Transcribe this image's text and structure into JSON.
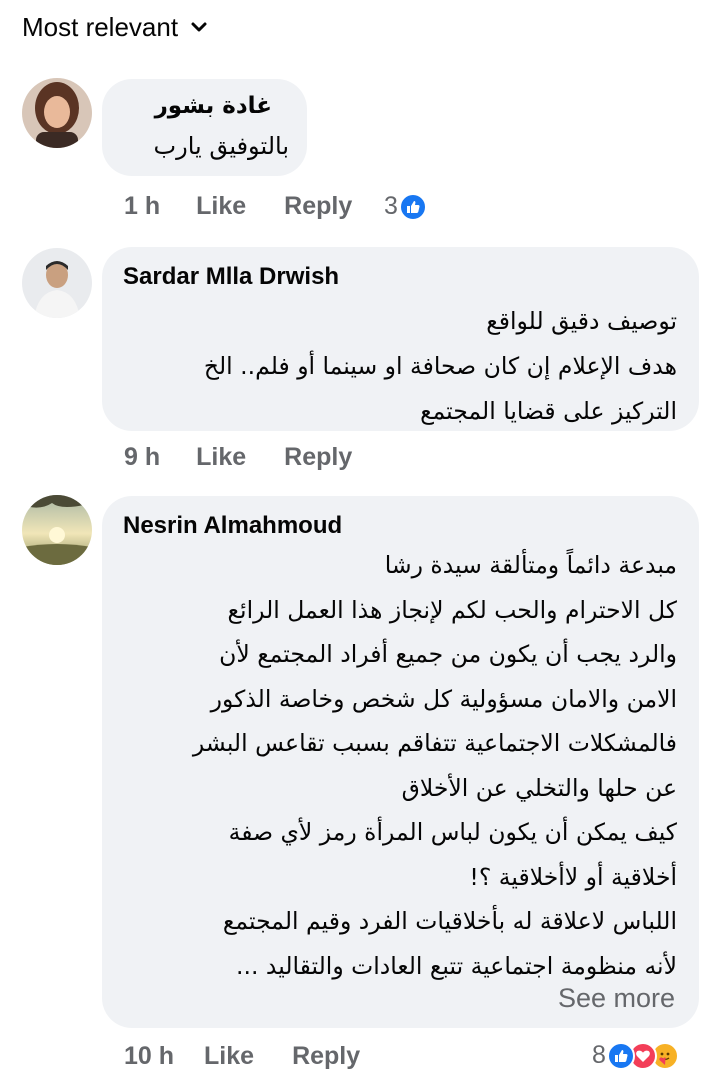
{
  "sort": {
    "label": "Most relevant"
  },
  "comments": [
    {
      "author": "غادة بشور",
      "lines": [
        "بالتوفيق يارب"
      ],
      "time": "1 h",
      "like": "Like",
      "reply": "Reply",
      "reaction_count": "3",
      "reactions": [
        "like-icon"
      ]
    },
    {
      "author": "Sardar Mlla Drwish",
      "lines": [
        "توصيف دقيق للواقع",
        "هدف الإعلام إن كان صحافة او سينما أو فلم.. الخ",
        "التركيز على قضايا المجتمع"
      ],
      "time": "9 h",
      "like": "Like",
      "reply": "Reply"
    },
    {
      "author": "Nesrin Almahmoud",
      "lines": [
        "مبدعة دائماً ومتألقة سيدة رشا",
        "كل الاحترام والحب لكم لإنجاز هذا العمل الرائع",
        "والرد يجب أن يكون من جميع أفراد المجتمع لأن",
        "الامن والامان مسؤولية كل شخص وخاصة الذكور",
        "فالمشكلات الاجتماعية تتفاقم بسبب تقاعس البشر",
        "عن حلها والتخلي عن الأخلاق",
        "كيف يمكن أن يكون لباس المرأة رمز لأي صفة",
        "أخلاقية أو لاأخلاقية ؟!",
        "اللباس لاعلاقة له بأخلاقيات الفرد وقيم المجتمع",
        "لأنه منظومة اجتماعية تتبع العادات والتقاليد ..."
      ],
      "see_more": "See more",
      "time": "10 h",
      "like": "Like",
      "reply": "Reply",
      "reaction_count": "8",
      "reactions": [
        "like-icon",
        "love-icon",
        "care-icon"
      ]
    }
  ],
  "colors": {
    "bubble": "#f0f2f5",
    "secondary_text": "#65676b",
    "like_blue": "#1877f2",
    "love_red": "#f33e58",
    "care_yellow": "#f7b125"
  }
}
